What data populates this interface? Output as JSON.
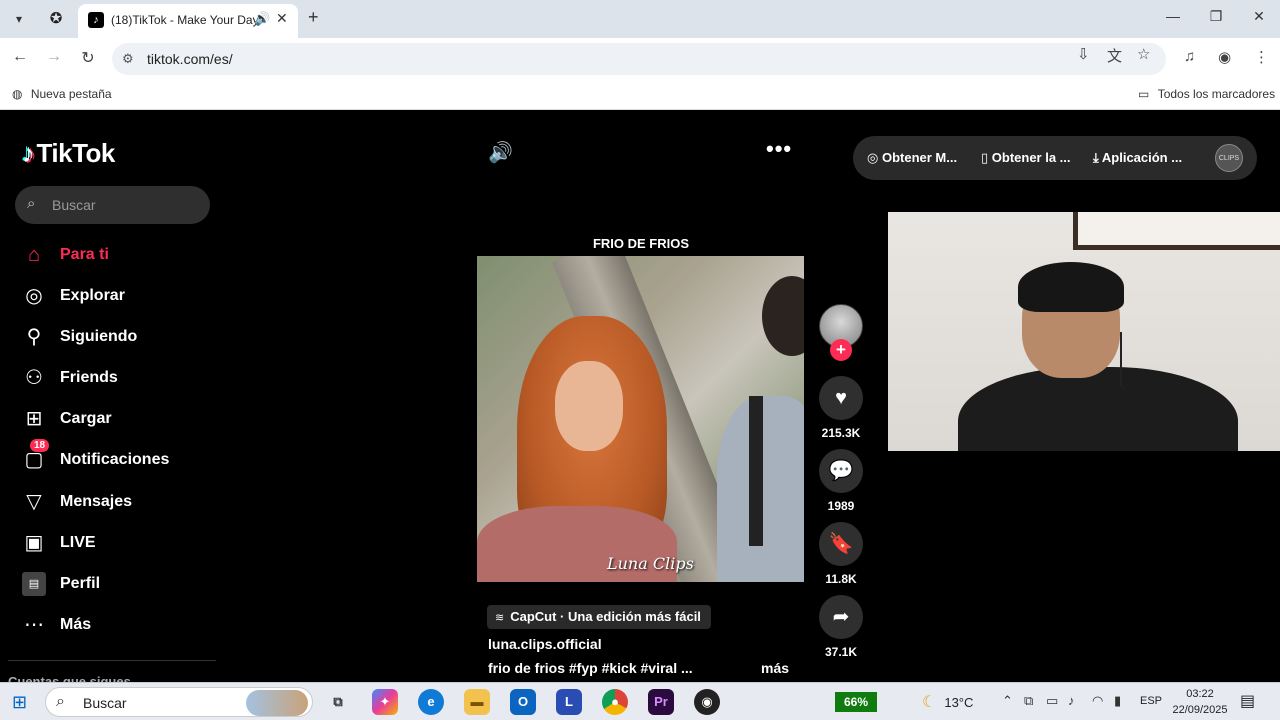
{
  "browser": {
    "tab_title": "(18)TikTok - Make Your Day",
    "url": "tiktok.com/es/",
    "bookmark_left": "Nueva pestaña",
    "bookmark_right": "Todos los marcadores"
  },
  "sidebar": {
    "search_placeholder": "Buscar",
    "items": [
      {
        "label": "Para ti",
        "icon": "home-icon"
      },
      {
        "label": "Explorar",
        "icon": "compass-icon"
      },
      {
        "label": "Siguiendo",
        "icon": "user-follow-icon"
      },
      {
        "label": "Friends",
        "icon": "friends-icon"
      },
      {
        "label": "Cargar",
        "icon": "upload-icon"
      },
      {
        "label": "Notificaciones",
        "icon": "inbox-icon",
        "badge": "18"
      },
      {
        "label": "Mensajes",
        "icon": "send-icon"
      },
      {
        "label": "LIVE",
        "icon": "live-icon"
      },
      {
        "label": "Perfil",
        "icon": "profile-avatar-icon"
      },
      {
        "label": "Más",
        "icon": "more-icon"
      }
    ],
    "following_header": "Cuentas que sigues"
  },
  "video": {
    "title": "FRIO DE FRIOS",
    "watermark": "Luna Clips",
    "likes": "215.3K",
    "comments": "1989",
    "saves": "11.8K",
    "shares": "37.1K",
    "capcut_label": "CapCut · Una edición más fácil",
    "author": "luna.clips.official",
    "description": "frio de frios #fyp #kick #viral ...",
    "more": "más"
  },
  "topbar": {
    "btn1": "Obtener M...",
    "btn2": "Obtener la ...",
    "btn3": "Aplicación ...",
    "avatar_text": "CLIPS"
  },
  "taskbar": {
    "search_placeholder": "Buscar",
    "battery": "66%",
    "temperature": "13°C",
    "language": "ESP",
    "time": "03:22",
    "date": "22/09/2025"
  },
  "colors": {
    "accent": "#fe2c55",
    "page_bg": "#000000"
  }
}
